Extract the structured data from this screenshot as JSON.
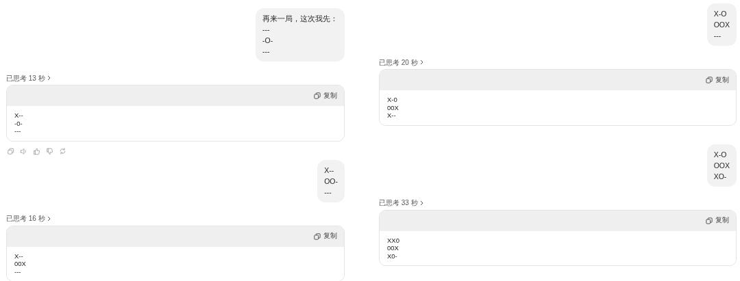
{
  "columns": [
    {
      "messages": [
        {
          "kind": "user",
          "lines": [
            "再来一局，这次我先：",
            "---",
            "-O-",
            "---"
          ]
        },
        {
          "kind": "assistant",
          "thought": "已思考 13 秒",
          "copy_label": "复制",
          "code": "X--\n-0-\n---"
        },
        {
          "kind": "actions"
        },
        {
          "kind": "user",
          "lines": [
            "X--",
            "OO-",
            "---"
          ]
        },
        {
          "kind": "assistant",
          "thought": "已思考 16 秒",
          "copy_label": "复制",
          "code": "X--\n00X\n---"
        }
      ]
    },
    {
      "messages": [
        {
          "kind": "user",
          "lines": [
            "X-O",
            "OOX",
            "---"
          ]
        },
        {
          "kind": "assistant",
          "thought": "已思考 20 秒",
          "copy_label": "复制",
          "code": "X-0\n00X\nX--"
        },
        {
          "kind": "user",
          "lines": [
            "X-O",
            "OOX",
            "XO-"
          ]
        },
        {
          "kind": "assistant",
          "thought": "已思考 33 秒",
          "copy_label": "复制",
          "code": "XX0\n00X\nX0-"
        }
      ]
    }
  ]
}
